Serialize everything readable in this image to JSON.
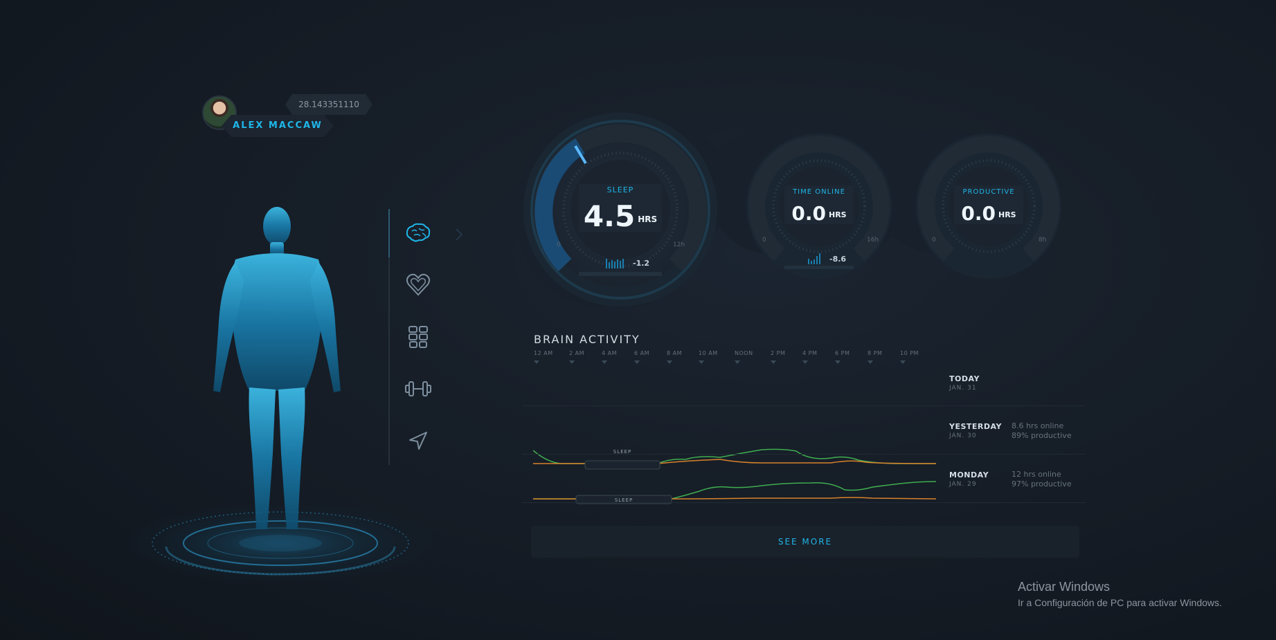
{
  "profile": {
    "name": "ALEX MACCAW",
    "coordinate": "28.143351110"
  },
  "nav": {
    "items": [
      {
        "icon": "brain-icon",
        "active": true
      },
      {
        "icon": "heart-icon",
        "active": false
      },
      {
        "icon": "abs-icon",
        "active": false
      },
      {
        "icon": "dumbbell-icon",
        "active": false
      },
      {
        "icon": "navigation-icon",
        "active": false
      }
    ]
  },
  "gauges": {
    "sleep": {
      "label": "SLEEP",
      "value": "4.5",
      "unit": "HRS",
      "min": "0",
      "max": "12h",
      "delta": "-1.2"
    },
    "time_online": {
      "label": "TIME ONLINE",
      "value": "0.0",
      "unit": "HRS",
      "min": "0",
      "max": "16h",
      "delta": "-8.6"
    },
    "productive": {
      "label": "PRODUCTIVE",
      "value": "0.0",
      "unit": "HRS",
      "min": "0",
      "max": "8h"
    }
  },
  "brain_activity": {
    "title": "BRAIN ACTIVITY",
    "times": [
      "12 AM",
      "2 AM",
      "4 AM",
      "6 AM",
      "8 AM",
      "10 AM",
      "NOON",
      "2 PM",
      "4 PM",
      "6 PM",
      "8 PM",
      "10 PM"
    ],
    "days": [
      {
        "name": "TODAY",
        "date": "JAN. 31",
        "online": "",
        "productive": ""
      },
      {
        "name": "YESTERDAY",
        "date": "JAN. 30",
        "online": "8.6 hrs online",
        "productive": "89% productive",
        "sleep_label": "SLEEP"
      },
      {
        "name": "MONDAY",
        "date": "JAN. 29",
        "online": "12 hrs online",
        "productive": "97% productive",
        "sleep_label": "SLEEP"
      }
    ],
    "series_colors": {
      "activity": "#3fae4f",
      "productivity": "#d9822b"
    }
  },
  "see_more": "SEE MORE",
  "windows": {
    "title": "Activar Windows",
    "subtitle": "Ir a Configuración de PC para activar Windows."
  },
  "colors": {
    "accent": "#1fb6e8",
    "background": "#151c25"
  }
}
